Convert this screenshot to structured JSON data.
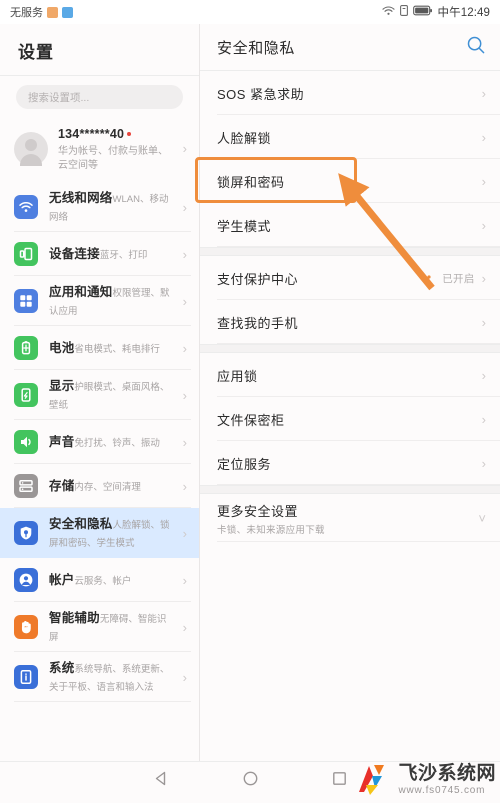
{
  "statusbar": {
    "carrier": "无服务",
    "time": "中午12:49",
    "icons": [
      "wifi-icon",
      "sim-icon",
      "battery-icon"
    ]
  },
  "sidebar": {
    "title": "设置",
    "search_placeholder": "搜索设置项...",
    "account": {
      "number": "134******40",
      "subtitle": "华为帐号、付款与账单、云空间等"
    },
    "items": [
      {
        "name": "无线和网络",
        "sub": "WLAN、移动网络",
        "icon": "wifi-icon",
        "color": "#4f7fe0"
      },
      {
        "name": "设备连接",
        "sub": "蓝牙、打印",
        "icon": "device-connect-icon",
        "color": "#43c45e"
      },
      {
        "name": "应用和通知",
        "sub": "权限管理、默认应用",
        "icon": "apps-grid-icon",
        "color": "#4f7fe0"
      },
      {
        "name": "电池",
        "sub": "省电模式、耗电排行",
        "icon": "battery-icon",
        "color": "#43c45e"
      },
      {
        "name": "显示",
        "sub": "护眼模式、桌面风格、壁纸",
        "icon": "display-icon",
        "color": "#43c45e"
      },
      {
        "name": "声音",
        "sub": "免打扰、铃声、振动",
        "icon": "sound-icon",
        "color": "#43c45e"
      },
      {
        "name": "存储",
        "sub": "内存、空间清理",
        "icon": "storage-icon",
        "color": "#9a9696"
      },
      {
        "name": "安全和隐私",
        "sub": "人脸解锁、锁屏和密码、学生模式",
        "icon": "shield-icon",
        "color": "#3a6fd8",
        "selected": true
      },
      {
        "name": "帐户",
        "sub": "云服务、帐户",
        "icon": "account-icon",
        "color": "#3a6fd8"
      },
      {
        "name": "智能辅助",
        "sub": "无障碍、智能识屏",
        "icon": "hand-icon",
        "color": "#ef7a2a"
      },
      {
        "name": "系统",
        "sub": "系统导航、系统更新、关于平板、语言和输入法",
        "icon": "system-info-icon",
        "color": "#3a6fd8"
      }
    ]
  },
  "panel": {
    "title": "安全和隐私",
    "search_icon": "search-icon",
    "groups": [
      {
        "rows": [
          {
            "name": "SOS 紧急求助",
            "value": "",
            "chevron": "chevron-right-icon"
          },
          {
            "name": "人脸解锁",
            "value": "",
            "chevron": "chevron-right-icon"
          },
          {
            "name": "锁屏和密码",
            "value": "",
            "chevron": "chevron-right-icon",
            "highlighted": true
          },
          {
            "name": "学生模式",
            "value": "",
            "chevron": "chevron-right-icon"
          }
        ]
      },
      {
        "rows": [
          {
            "name": "支付保护中心",
            "value": "已开启",
            "chevron": "chevron-right-icon"
          },
          {
            "name": "查找我的手机",
            "value": "",
            "chevron": "chevron-right-icon"
          }
        ]
      },
      {
        "rows": [
          {
            "name": "应用锁",
            "value": "",
            "chevron": "chevron-right-icon"
          },
          {
            "name": "文件保密柜",
            "value": "",
            "chevron": "chevron-right-icon"
          },
          {
            "name": "定位服务",
            "value": "",
            "chevron": "chevron-right-icon"
          }
        ]
      },
      {
        "rows": [
          {
            "name": "更多安全设置",
            "sub": "卡锁、未知来源应用下载",
            "value": "",
            "chevron": "chevron-down-icon"
          }
        ]
      }
    ]
  },
  "annotation": {
    "highlight_color": "#ef8d3c",
    "arrow_color": "#ef8d3c",
    "target": "锁屏和密码"
  },
  "navbar": {
    "buttons": [
      "back-triangle-icon",
      "home-circle-icon",
      "recents-square-icon"
    ]
  },
  "watermark": {
    "name": "飞沙系统网",
    "url": "www.fs0745.com",
    "colors": [
      "#e8302a",
      "#f07a1f",
      "#2196d8",
      "#f5c518"
    ]
  }
}
